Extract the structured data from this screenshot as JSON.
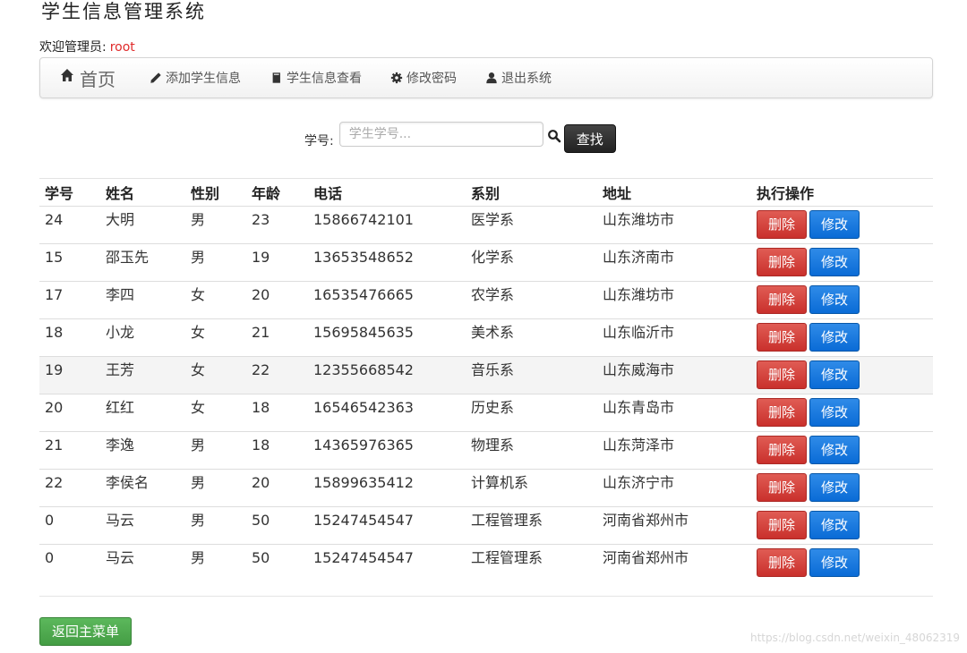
{
  "app": {
    "title": "学生信息管理系统",
    "welcome_label": "欢迎管理员:",
    "username": "root"
  },
  "nav": {
    "items": [
      {
        "label": "首页",
        "icon": "home-icon"
      },
      {
        "label": "添加学生信息",
        "icon": "pencil-icon"
      },
      {
        "label": "学生信息查看",
        "icon": "book-icon"
      },
      {
        "label": "修改密码",
        "icon": "gear-icon"
      },
      {
        "label": "退出系统",
        "icon": "user-icon"
      }
    ]
  },
  "search": {
    "label": "学号:",
    "placeholder": "学生学号...",
    "value": "",
    "button_label": "查找"
  },
  "table": {
    "headers": [
      "学号",
      "姓名",
      "性别",
      "年龄",
      "电话",
      "系别",
      "地址",
      "执行操作"
    ],
    "rows": [
      [
        "24",
        "大明",
        "男",
        "23",
        "15866742101",
        "医学系",
        "山东潍坊市"
      ],
      [
        "15",
        "邵玉先",
        "男",
        "19",
        "13653548652",
        "化学系",
        "山东济南市"
      ],
      [
        "17",
        "李四",
        "女",
        "20",
        "16535476665",
        "农学系",
        "山东潍坊市"
      ],
      [
        "18",
        "小龙",
        "女",
        "21",
        "15695845635",
        "美术系",
        "山东临沂市"
      ],
      [
        "19",
        "王芳",
        "女",
        "22",
        "12355668542",
        "音乐系",
        "山东威海市"
      ],
      [
        "20",
        "红红",
        "女",
        "18",
        "16546542363",
        "历史系",
        "山东青岛市"
      ],
      [
        "21",
        "李逸",
        "男",
        "18",
        "14365976365",
        "物理系",
        "山东菏泽市"
      ],
      [
        "22",
        "李侯名",
        "男",
        "20",
        "15899635412",
        "计算机系",
        "山东济宁市"
      ],
      [
        "0",
        "马云",
        "男",
        "50",
        "15247454547",
        "工程管理系",
        "河南省郑州市"
      ],
      [
        "0",
        "马云",
        "男",
        "50",
        "15247454547",
        "工程管理系",
        "河南省郑州市"
      ]
    ],
    "highlighted_row": 4,
    "delete_label": "删除",
    "edit_label": "修改"
  },
  "footer": {
    "back_label": "返回主菜单",
    "watermark": "https://blog.csdn.net/weixin_48062319"
  },
  "colors": {
    "username": "#e02a2a",
    "delete": "#d9534f",
    "edit": "#0e76e0",
    "back": "#5cb85c",
    "search_button": "#333333"
  }
}
